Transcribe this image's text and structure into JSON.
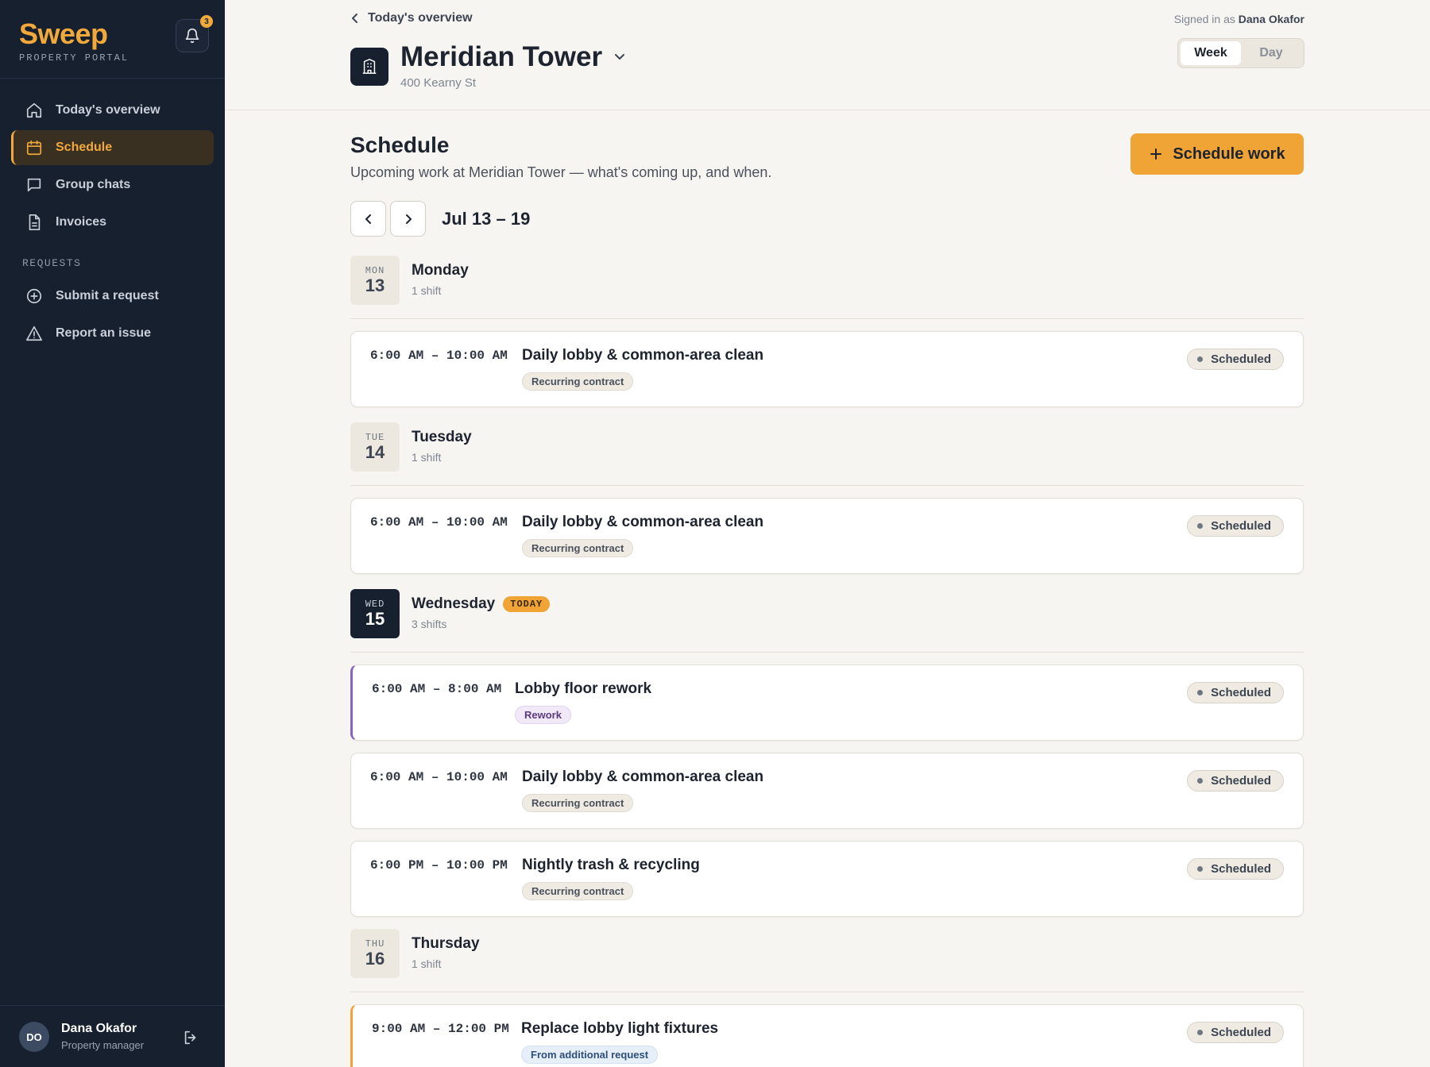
{
  "brand": {
    "name": "Sweep",
    "subtitle": "PROPERTY PORTAL"
  },
  "notifications": {
    "count": "3"
  },
  "sidebar": {
    "items": [
      {
        "label": "Today's overview",
        "icon": "home-icon"
      },
      {
        "label": "Schedule",
        "icon": "calendar-icon",
        "active": true
      },
      {
        "label": "Group chats",
        "icon": "chat-icon"
      },
      {
        "label": "Invoices",
        "icon": "document-icon"
      }
    ],
    "requests_heading": "REQUESTS",
    "request_items": [
      {
        "label": "Submit a request",
        "icon": "plus-circle-icon"
      },
      {
        "label": "Report an issue",
        "icon": "warning-icon"
      }
    ]
  },
  "user": {
    "initials": "DO",
    "name": "Dana Okafor",
    "role": "Property manager"
  },
  "header": {
    "breadcrumb": "Today's overview",
    "signed_in_prefix": "Signed in as",
    "signed_in_name": "Dana Okafor",
    "building_name": "Meridian Tower",
    "building_address": "400 Kearny St",
    "view_toggle": {
      "week": "Week",
      "day": "Day",
      "selected": "Week"
    }
  },
  "main": {
    "title": "Schedule",
    "subtitle": "Upcoming work at Meridian Tower — what's coming up, and when.",
    "cta_label": "Schedule work",
    "week_range": "Jul 13 – 19",
    "today_label": "TODAY",
    "days": [
      {
        "dow": "MON",
        "date": "13",
        "name": "Monday",
        "count": "1 shift",
        "shifts": [
          {
            "time": "6:00 AM – 10:00 AM",
            "title": "Daily lobby & common-area clean",
            "tag": "Recurring contract",
            "status": "Scheduled"
          }
        ]
      },
      {
        "dow": "TUE",
        "date": "14",
        "name": "Tuesday",
        "count": "1 shift",
        "shifts": [
          {
            "time": "6:00 AM – 10:00 AM",
            "title": "Daily lobby & common-area clean",
            "tag": "Recurring contract",
            "status": "Scheduled"
          }
        ]
      },
      {
        "dow": "WED",
        "date": "15",
        "name": "Wednesday",
        "count": "3 shifts",
        "shifts": [
          {
            "time": "6:00 AM – 8:00 AM",
            "title": "Lobby floor rework",
            "tag": "Rework",
            "status": "Scheduled"
          },
          {
            "time": "6:00 AM – 10:00 AM",
            "title": "Daily lobby & common-area clean",
            "tag": "Recurring contract",
            "status": "Scheduled"
          },
          {
            "time": "6:00 PM – 10:00 PM",
            "title": "Nightly trash & recycling",
            "tag": "Recurring contract",
            "status": "Scheduled"
          }
        ]
      },
      {
        "dow": "THU",
        "date": "16",
        "name": "Thursday",
        "count": "1 shift",
        "shifts": [
          {
            "time": "9:00 AM – 12:00 PM",
            "title": "Replace lobby light fixtures",
            "tag": "From additional request",
            "status": "Scheduled"
          }
        ]
      }
    ]
  },
  "colors": {
    "accent": "#f0a436",
    "sidebar_bg": "#17202e",
    "rework": "#8b63b8"
  }
}
